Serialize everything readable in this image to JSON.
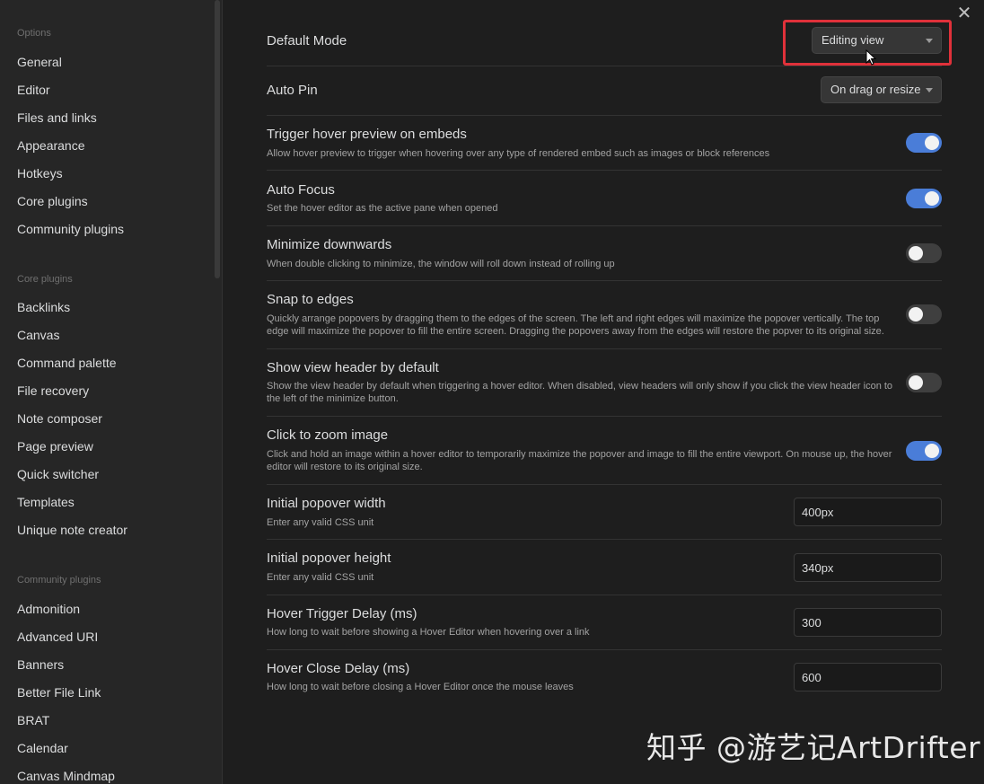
{
  "sidebar": {
    "sections": [
      {
        "heading": "Options",
        "items": [
          "General",
          "Editor",
          "Files and links",
          "Appearance",
          "Hotkeys",
          "Core plugins",
          "Community plugins"
        ]
      },
      {
        "heading": "Core plugins",
        "items": [
          "Backlinks",
          "Canvas",
          "Command palette",
          "File recovery",
          "Note composer",
          "Page preview",
          "Quick switcher",
          "Templates",
          "Unique note creator"
        ]
      },
      {
        "heading": "Community plugins",
        "items": [
          "Admonition",
          "Advanced URI",
          "Banners",
          "Better File Link",
          "BRAT",
          "Calendar",
          "Canvas Mindmap"
        ]
      }
    ]
  },
  "settings": [
    {
      "title": "Default Mode",
      "desc": "",
      "control": "dropdown",
      "value": "Editing view"
    },
    {
      "title": "Auto Pin",
      "desc": "",
      "control": "dropdown",
      "value": "On drag or resize"
    },
    {
      "title": "Trigger hover preview on embeds",
      "desc": "Allow hover preview to trigger when hovering over any type of rendered embed such as images or block references",
      "control": "toggle",
      "value": true
    },
    {
      "title": "Auto Focus",
      "desc": "Set the hover editor as the active pane when opened",
      "control": "toggle",
      "value": true
    },
    {
      "title": "Minimize downwards",
      "desc": "When double clicking to minimize, the window will roll down instead of rolling up",
      "control": "toggle",
      "value": false
    },
    {
      "title": "Snap to edges",
      "desc": "Quickly arrange popovers by dragging them to the edges of the screen. The left and right edges will maximize the popover vertically. The top edge will maximize the popover to fill the entire screen. Dragging the popovers away from the edges will restore the popver to its original size.",
      "control": "toggle",
      "value": false
    },
    {
      "title": "Show view header by default",
      "desc": "Show the view header by default when triggering a hover editor. When disabled, view headers will only show if you click the view header icon to the left of the minimize button.",
      "control": "toggle",
      "value": false
    },
    {
      "title": "Click to zoom image",
      "desc": "Click and hold an image within a hover editor to temporarily maximize the popover and image to fill the entire viewport. On mouse up, the hover editor will restore to its original size.",
      "control": "toggle",
      "value": true
    },
    {
      "title": "Initial popover width",
      "desc": "Enter any valid CSS unit",
      "control": "text",
      "value": "400px"
    },
    {
      "title": "Initial popover height",
      "desc": "Enter any valid CSS unit",
      "control": "text",
      "value": "340px"
    },
    {
      "title": "Hover Trigger Delay (ms)",
      "desc": "How long to wait before showing a Hover Editor when hovering over a link",
      "control": "text",
      "value": "300"
    },
    {
      "title": "Hover Close Delay (ms)",
      "desc": "How long to wait before closing a Hover Editor once the mouse leaves",
      "control": "text",
      "value": "600"
    }
  ],
  "close_icon": "✕",
  "watermark": "知乎 @游艺记ArtDrifter",
  "colors": {
    "accent": "#4a7dd8",
    "highlight": "#e0313a"
  }
}
